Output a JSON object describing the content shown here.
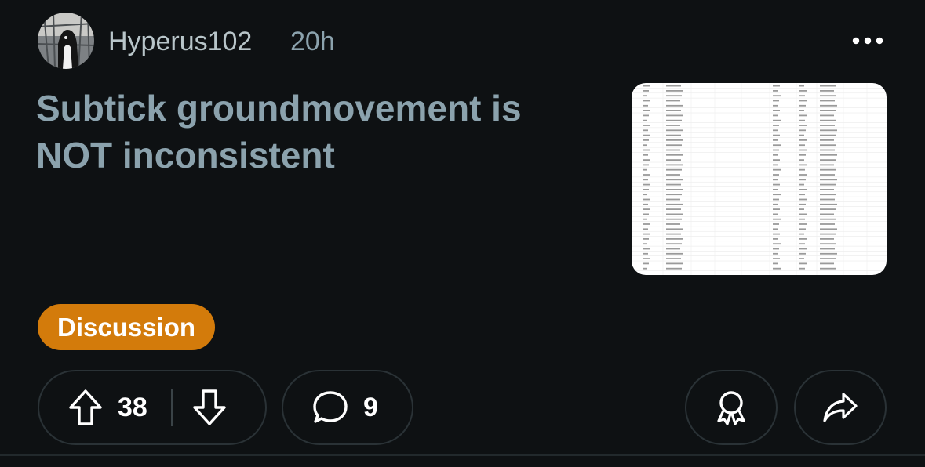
{
  "post": {
    "author": "Hyperus102",
    "age": "20h",
    "title": "Subtick groundmovement is NOT inconsistent",
    "flair": "Discussion",
    "flair_color": "#d37b0b",
    "title_color": "#8ba2ad",
    "upvotes": "38",
    "comments": "9"
  },
  "icons": {
    "more": "more-horizontal-icon",
    "upvote": "arrow-up-icon",
    "downvote": "arrow-down-icon",
    "comment": "comment-bubble-icon",
    "award": "award-ribbon-icon",
    "share": "share-arrow-icon"
  },
  "colors": {
    "background": "#0e1113",
    "border": "#2a3236"
  }
}
